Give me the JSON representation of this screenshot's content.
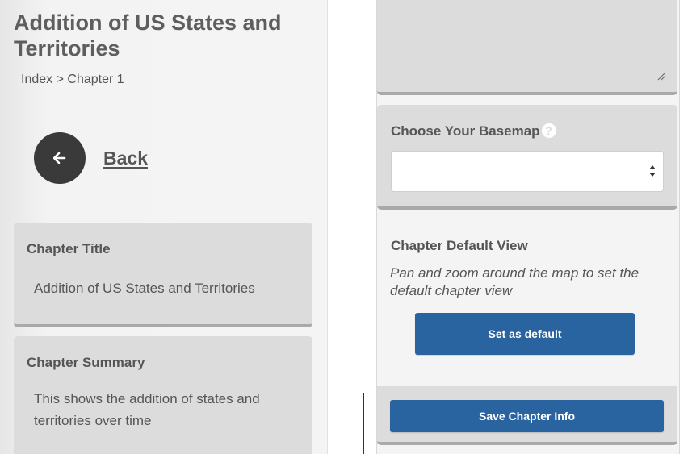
{
  "left": {
    "title": "Addition of US States and Territories",
    "breadcrumb": {
      "index": "Index",
      "separator": ">",
      "current": "Chapter 1"
    },
    "back": {
      "label": "Back",
      "icon": "arrow-left-icon"
    },
    "chapter_title": {
      "label": "Chapter Title",
      "value": "Addition of US States and Territories"
    },
    "chapter_summary": {
      "label": "Chapter Summary",
      "value": "This shows the addition of states and territories over time"
    }
  },
  "right": {
    "basemap": {
      "label": "Choose Your Basemap",
      "help_icon": "question-icon",
      "selected": ""
    },
    "default_view": {
      "label": "Chapter Default View",
      "hint": "Pan and zoom around the map to set the default chapter view",
      "button_label": "Set as default"
    },
    "save_button_label": "Save Chapter Info"
  },
  "colors": {
    "button_blue": "#2a64a0",
    "card_bg": "#dcdcdc",
    "panel_bg": "#f4f4f4",
    "text": "#555555",
    "back_circle": "#3a3a3a"
  }
}
